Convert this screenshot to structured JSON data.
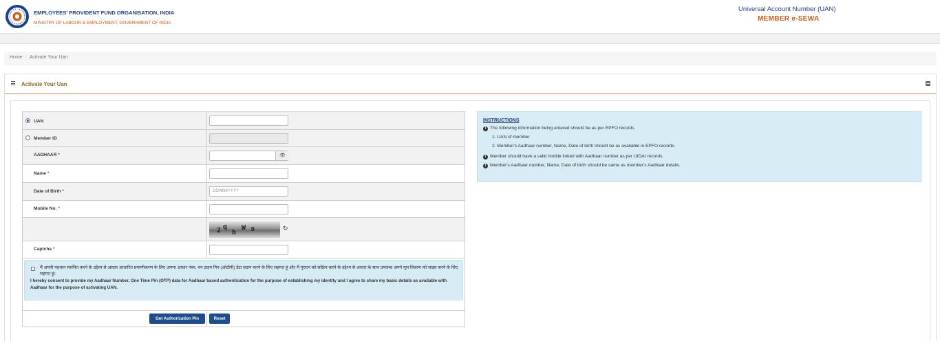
{
  "header": {
    "org_name": "EMPLOYEES' PROVIDENT FUND ORGANISATION, INDIA",
    "ministry": "MINISTRY OF LABOUR & EMPLOYMENT, GOVERNMENT OF INDIA",
    "uan_title": "Universal Account Number (UAN)",
    "service_name": "MEMBER e-SEWA",
    "logo_icon": "epfo-emblem-icon"
  },
  "breadcrumb": {
    "home": "Home",
    "separator": "/",
    "current": "Activate Your Uan"
  },
  "panel": {
    "title": "Activate Your Uan",
    "menu_icon": "bars-icon",
    "collapse_icon": "minus-square-icon"
  },
  "form": {
    "uan_radio": {
      "label": "UAN",
      "selected": true
    },
    "member_id_radio": {
      "label": "Member ID",
      "selected": false
    },
    "aadhaar_label": "AADHAAR",
    "name_label": "Name",
    "dob_label": "Date of Birth",
    "dob_placeholder": "DD/MM/YYYY",
    "mobile_label": "Mobile No.",
    "captcha_label": "Captcha",
    "required_mark": "*",
    "captcha_chars": [
      "2",
      "q",
      "h",
      "W",
      "D"
    ],
    "eye_icon": "eye-icon",
    "refresh_icon": "refresh-icon",
    "consent_hindi": "मैं अपनी पहचान स्थापित करने के उद्देश्य से आधार आधारित प्रमाणीकरण के लिए अपना आधार नंबर, वन टाइम पिन (ओटीपी) डेटा प्रदान करने के लिए सहमत हूं और मैं यूएएन को सक्रिय करने के उद्देश्य से आधार के साथ उपलब्ध अपने मूल विवरण को साझा करने के लिए सहमत हूं।",
    "consent_english": "I hereby consent to provide my Aadhaar Number, One Time Pin (OTP) data for Aadhaar based authentication for the purpose of establishing my identity and I agree to share my basic details as available with Aadhaar for the purpose of activating UAN.",
    "get_pin_button": "Get Authorization Pin",
    "reset_button": "Reset"
  },
  "instructions": {
    "heading": "INSTRUCTIONS",
    "info_icon": "info-circle-icon",
    "line1": "The following information being entered should be as per EPFO records",
    "sub1": "1. UAN of member",
    "sub2": "2. Member's Aadhaar number, Name, Date of birth should be as available in EPFO records.",
    "line2": "Member should have a valid mobile linked with Aadhaar number as per UIDAI records.",
    "line3": "Member's Aadhaar number, Name, Date of birth should be same as member's Aadhaar details."
  },
  "colors": {
    "brand_blue": "#1e3f8a",
    "brand_orange": "#c65b1a",
    "panel_title": "#8b6a28",
    "button": "#1e4d8c",
    "info_bg": "#d8ecf6"
  }
}
